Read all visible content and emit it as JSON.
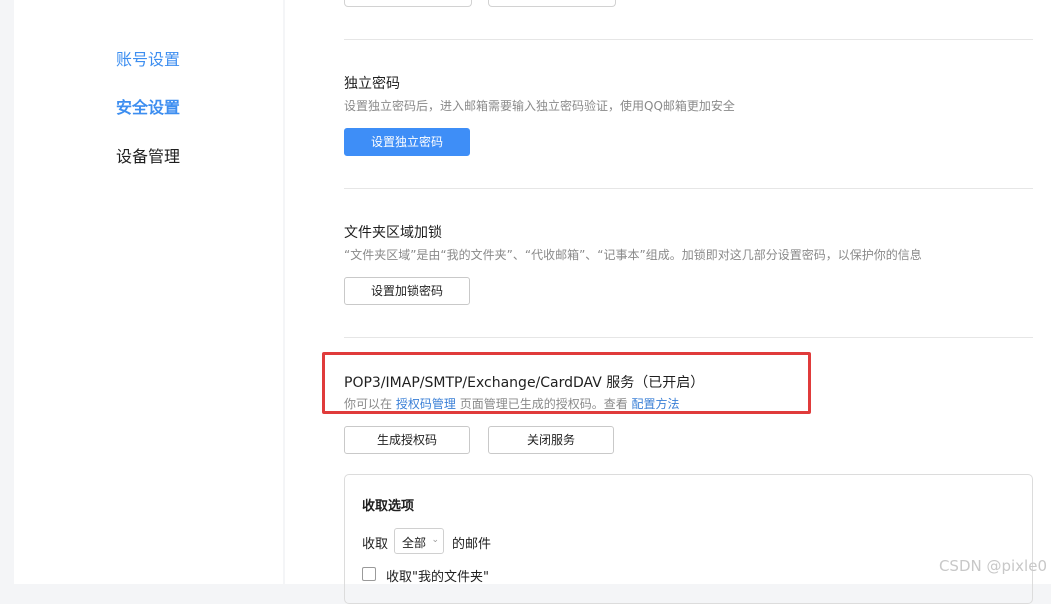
{
  "sidebar": {
    "items": [
      {
        "label": "账号设置"
      },
      {
        "label": "安全设置"
      },
      {
        "label": "设备管理"
      }
    ]
  },
  "independent_password": {
    "title": "独立密码",
    "description": "设置独立密码后，进入邮箱需要输入独立密码验证，使用QQ邮箱更加安全",
    "button_label": "设置独立密码"
  },
  "folder_lock": {
    "title": "文件夹区域加锁",
    "description": "“文件夹区域”是由“我的文件夹”、“代收邮箱”、“记事本”组成。加锁即对这几部分设置密码，以保护你的信息",
    "button_label": "设置加锁密码"
  },
  "services": {
    "title": "POP3/IMAP/SMTP/Exchange/CardDAV 服务（已开启）",
    "desc_prefix": "你可以在",
    "link_auth": "授权码管理",
    "desc_middle": "页面管理已生成的授权码。查看",
    "link_config": "配置方法",
    "generate_button": "生成授权码",
    "close_button": "关闭服务"
  },
  "fetch_options": {
    "title": "收取选项",
    "prefix": "收取",
    "selected": "全部",
    "suffix": "的邮件",
    "checkbox_label": "收取\"我的文件夹\""
  },
  "watermark": "CSDN @pixle0",
  "colors": {
    "accent": "#3e8ef7",
    "highlight_border": "#e03b3b"
  }
}
